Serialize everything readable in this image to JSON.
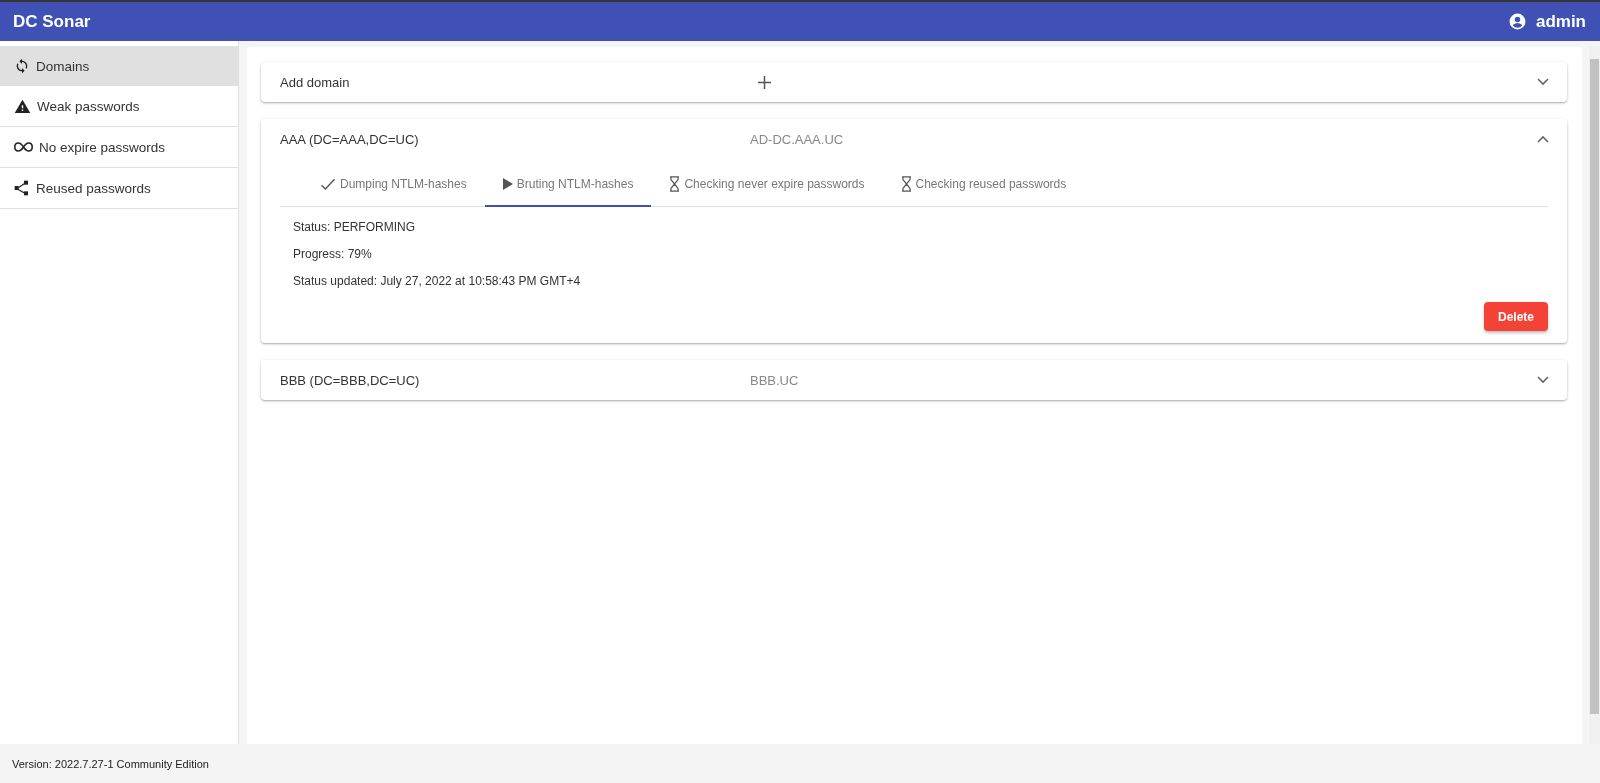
{
  "app_bar": {
    "title": "DC Sonar",
    "user": "admin"
  },
  "sidebar": {
    "items": [
      {
        "label": "Domains",
        "selected": true
      },
      {
        "label": "Weak passwords",
        "selected": false
      },
      {
        "label": "No expire passwords",
        "selected": false
      },
      {
        "label": "Reused passwords",
        "selected": false
      }
    ]
  },
  "panels": [
    {
      "kind": "add",
      "title": "Add domain",
      "expanded": false
    },
    {
      "kind": "domain",
      "title": "AAA (DC=AAA,DC=UC)",
      "host": "AD-DC.AAA.UC",
      "expanded": true,
      "tabs": [
        {
          "label": "Dumping NTLM-hashes",
          "kind": "done",
          "selected": false
        },
        {
          "label": "Bruting NTLM-hashes",
          "kind": "running",
          "selected": true
        },
        {
          "label": "Checking never expire passwords",
          "kind": "waiting",
          "selected": false
        },
        {
          "label": "Checking reused passwords",
          "kind": "waiting",
          "selected": false
        }
      ],
      "details": [
        "Status: PERFORMING",
        "Progress: 79%",
        "Status updated: July 27, 2022 at 10:58:43 PM GMT+4"
      ],
      "delete_button": "Delete"
    },
    {
      "kind": "domain",
      "title": "BBB (DC=BBB,DC=UC)",
      "host": "BBB.UC",
      "expanded": false
    }
  ],
  "footer": "Version: 2022.7.27-1 Community Edition"
}
